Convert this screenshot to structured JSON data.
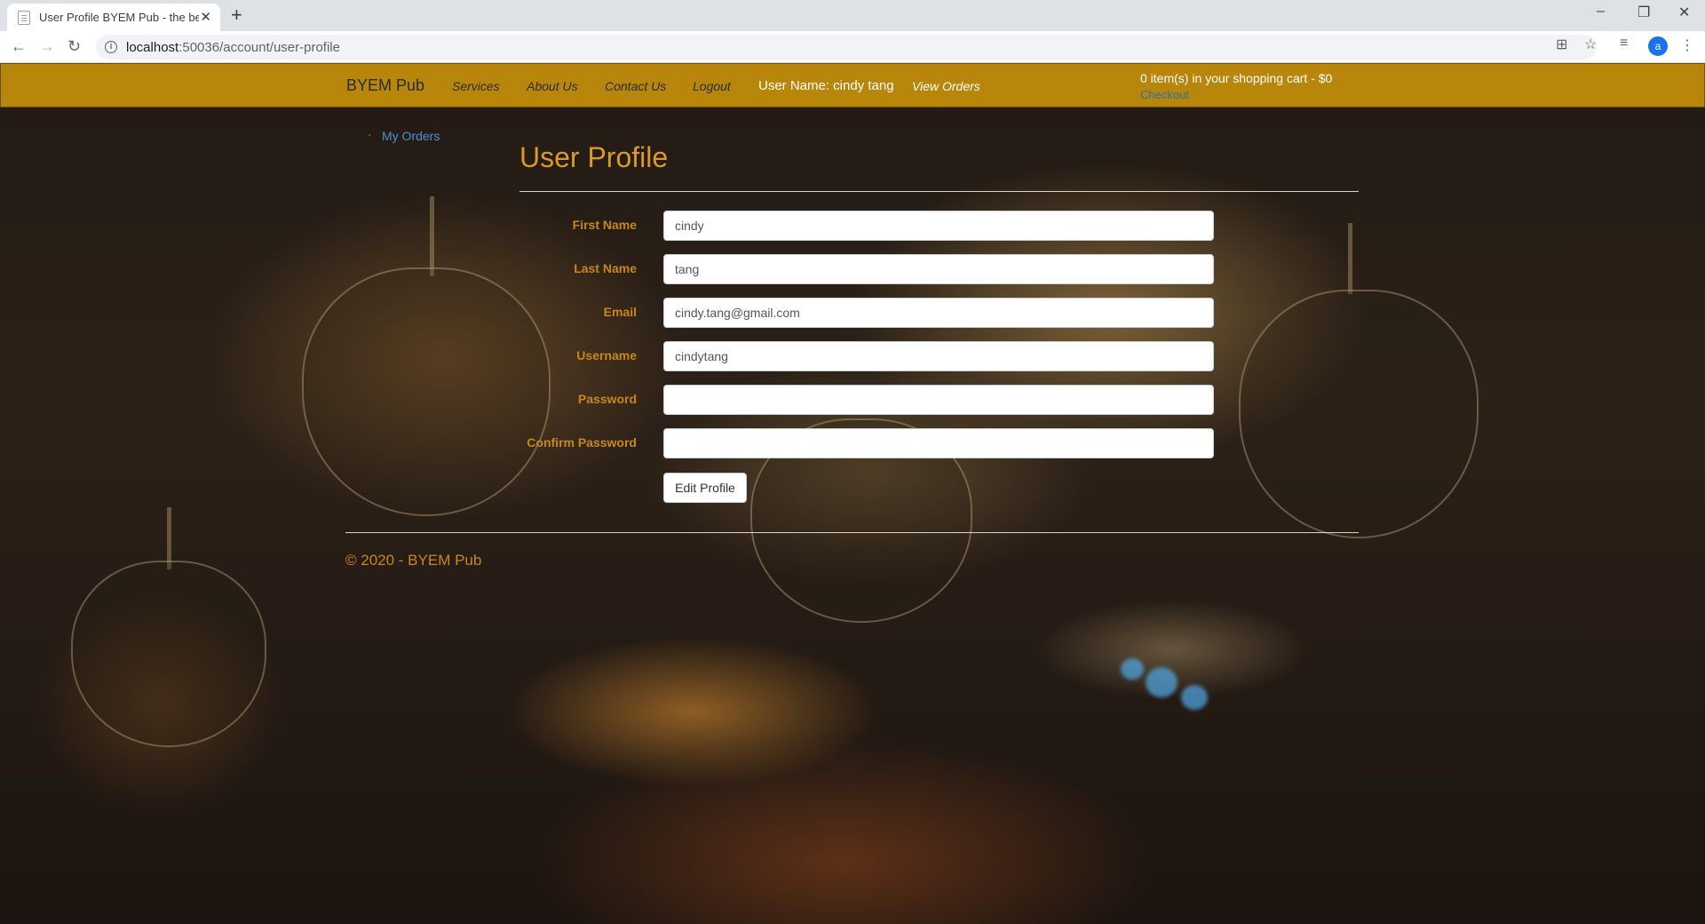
{
  "browser": {
    "tab_title": "User Profile BYEM Pub - the be",
    "url_prefix": "localhost",
    "url_rest": ":50036/account/user-profile",
    "profile_initial": "a"
  },
  "nav": {
    "brand": "BYEM Pub",
    "services": "Services",
    "about": "About Us",
    "contact": "Contact Us",
    "logout": "Logout",
    "user": "User Name: cindy tang",
    "orders": "View Orders",
    "cart": "0 item(s) in your shopping cart - $0",
    "checkout": "Checkout"
  },
  "sidebar": {
    "my_orders": "My Orders"
  },
  "profile": {
    "title": "User Profile",
    "fields": [
      {
        "label": "First Name",
        "value": "cindy"
      },
      {
        "label": "Last Name",
        "value": "tang"
      },
      {
        "label": "Email",
        "value": "cindy.tang@gmail.com"
      },
      {
        "label": "Username",
        "value": "cindytang"
      },
      {
        "label": "Password",
        "value": ""
      },
      {
        "label": "Confirm Password",
        "value": ""
      }
    ],
    "submit": "Edit Profile"
  },
  "footer": {
    "copyright": "© 2020 - BYEM Pub"
  },
  "colors": {
    "navbar": "#b8860b",
    "accent": "#d99a2b",
    "label": "#c8871a",
    "link": "#4a90d9"
  }
}
